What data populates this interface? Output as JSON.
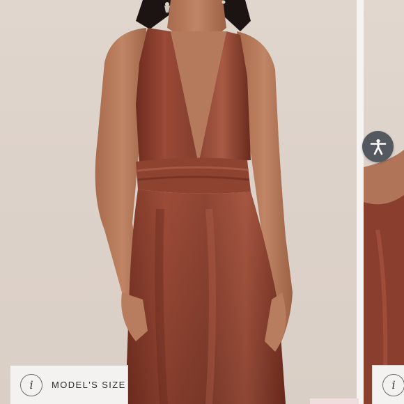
{
  "product_gallery": {
    "main_image_alt": "",
    "info_icon_glyph": "i",
    "model_size_label": "MODEL'S SIZE"
  },
  "colors": {
    "dress": "#8a3f2e",
    "accessibility_button": "#54595f"
  },
  "icons": {
    "accessibility": "accessibility-person-icon",
    "info": "info-icon"
  }
}
